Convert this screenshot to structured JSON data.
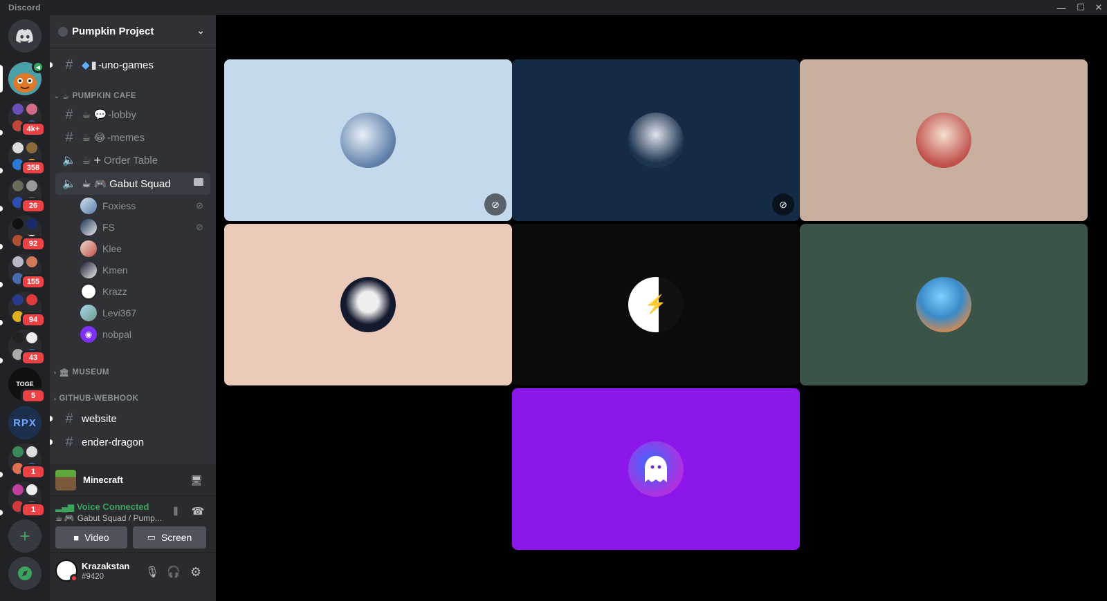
{
  "window": {
    "title": "Discord",
    "minimize": "—",
    "maximize": "☐",
    "close": "✕"
  },
  "guilds": {
    "badges": [
      "4k+",
      "358",
      "26",
      "92",
      "155",
      "94",
      "43",
      "5",
      "1",
      "1"
    ],
    "rpx_label": "RPX",
    "toge_label": "TOGE"
  },
  "server": {
    "name": "Pumpkin Project"
  },
  "channels": {
    "uno": "-uno-games",
    "category_cafe": "PUMPKIN CAFE",
    "lobby": "-lobby",
    "memes": "-memes",
    "order_table": "Order Table",
    "gabut_squad": "Gabut Squad",
    "category_museum": "MUSEUM",
    "category_github": "GITHUB-WEBHOOK",
    "website": "website",
    "ender_dragon": "ender-dragon"
  },
  "voice_users": [
    {
      "name": "Foxiess",
      "muted": true,
      "color": "#9bb8d8"
    },
    {
      "name": "FS",
      "muted": true,
      "color": "#1e3550"
    },
    {
      "name": "Klee",
      "muted": false,
      "color": "#c0504a"
    },
    {
      "name": "Kmen",
      "muted": false,
      "color": "#141a2e"
    },
    {
      "name": "Krazz",
      "muted": false,
      "color": "#ffffff"
    },
    {
      "name": "Levi367",
      "muted": false,
      "color": "#6f9a8a"
    },
    {
      "name": "nobpal",
      "muted": false,
      "color": "#7b2ff7"
    }
  ],
  "activity": {
    "game": "Minecraft"
  },
  "voice": {
    "status": "Voice Connected",
    "location": "Gabut Squad / Pump...",
    "video_label": "Video",
    "screen_label": "Screen"
  },
  "user": {
    "name": "Krazakstan",
    "tag": "#9420"
  },
  "tiles": [
    {
      "bg": "#c5d9ec",
      "muted": true
    },
    {
      "bg": "#152b45",
      "muted": true
    },
    {
      "bg": "#c8afa0",
      "muted": false
    },
    {
      "bg": "#ebcab9",
      "muted": false
    },
    {
      "bg": "#0b0b0b",
      "muted": false
    },
    {
      "bg": "#3a5447",
      "muted": false
    },
    {
      "bg": "#8b17ea",
      "muted": false
    }
  ],
  "colors": {
    "accent": "#5865f2",
    "green": "#3ba55d",
    "red": "#ed4245"
  }
}
